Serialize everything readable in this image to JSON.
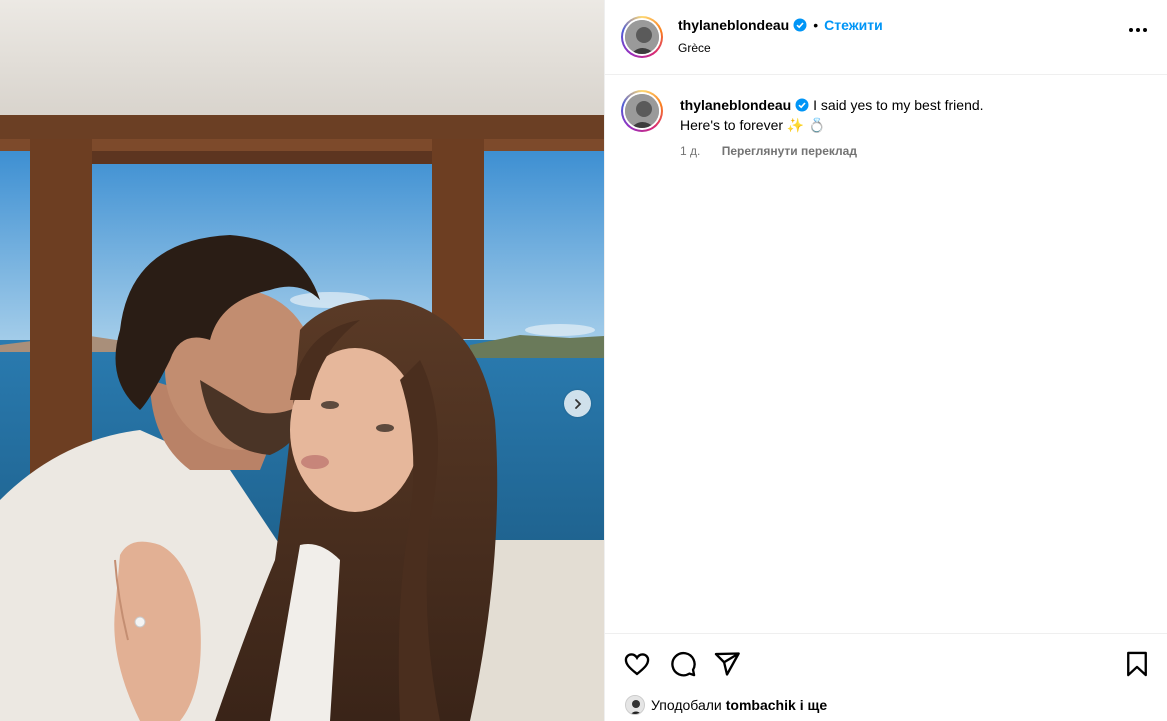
{
  "post": {
    "username": "thylaneblondeau",
    "follow_label": "Стежити",
    "dot": "•",
    "location": "Grèce",
    "caption_line1": "I said yes to my best friend.",
    "caption_line2": "Here's to forever ✨ 💍",
    "time_ago": "1 д.",
    "translate_label": "Переглянути переклад",
    "liked_by_prefix": "Уподобали",
    "liked_by_user": "tombachik",
    "liked_by_suffix": "і ще"
  },
  "icons": {
    "verified": "verified-badge-icon",
    "more": "more-options-icon",
    "like": "heart-icon",
    "comment": "comment-icon",
    "share": "send-icon",
    "save": "bookmark-icon",
    "next": "chevron-right-icon"
  },
  "colors": {
    "accent": "#0095f6",
    "muted": "#737373",
    "border": "#efefef"
  }
}
